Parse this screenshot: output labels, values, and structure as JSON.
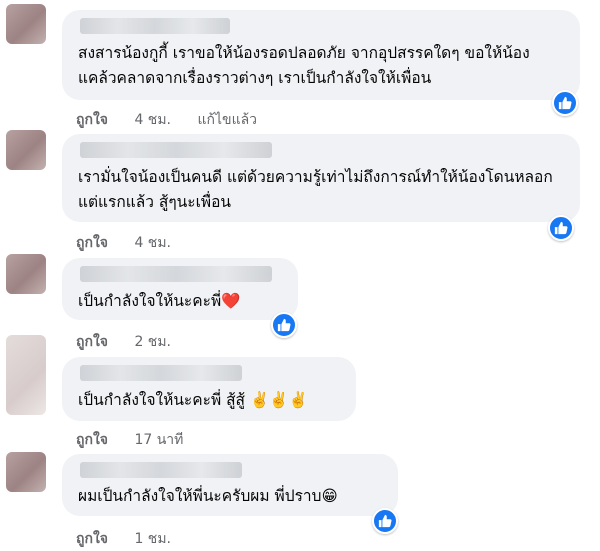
{
  "comments": [
    {
      "text": "สงสารน้องกูกี้ เราขอให้น้องรอดปลอดภัย จากอุปสรรคใดๆ ขอให้น้องแคล้วคลาดจากเรื่องราวต่างๆ เราเป็นกำลังใจให้เพื่อน",
      "like_label": "ถูกใจ",
      "time": "4 ชม.",
      "edited": "แก้ไขแล้ว"
    },
    {
      "text": "เรามั่นใจน้องเป็นคนดี แต่ด้วยความรู้เท่าไม่ถึงการณ์ทำให้น้องโดนหลอกแต่แรกแล้ว สู้ๆนะเพื่อน",
      "like_label": "ถูกใจ",
      "time": "4 ชม."
    },
    {
      "text": "เป็นกำลังใจให้นะคะพี่",
      "emoji": "❤️",
      "like_label": "ถูกใจ",
      "time": "2 ชม."
    },
    {
      "text": "เป็นกำลังใจให้นะคะพี่ สู้สู้",
      "emoji": "✌️✌️✌️",
      "like_label": "ถูกใจ",
      "time": "17 นาที"
    },
    {
      "text": "ผมเป็นกำลังใจให้พี่นะครับผม พี่ปราบ",
      "emoji": "😁",
      "like_label": "ถูกใจ",
      "time": "1 ชม."
    }
  ],
  "icons": {
    "reaction": "thumbs-up-icon"
  },
  "colors": {
    "like_blue": "#1877f2",
    "bubble": "#f0f2f5",
    "meta": "#65676b"
  }
}
